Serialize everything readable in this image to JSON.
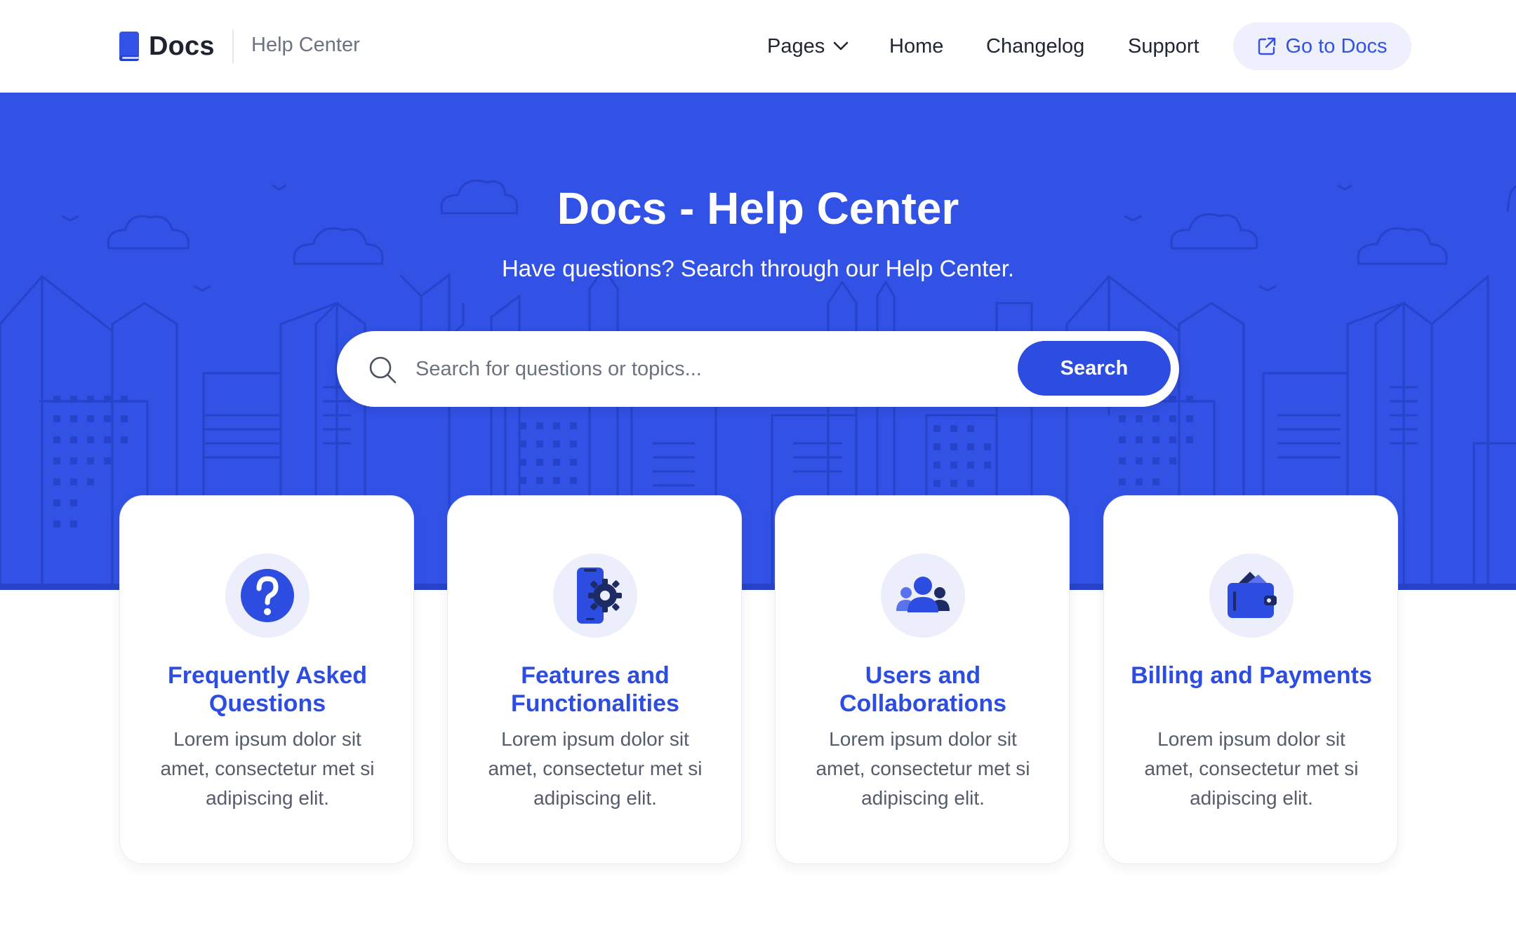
{
  "header": {
    "brand_name": "Docs",
    "brand_sub": "Help Center",
    "nav": {
      "pages": "Pages",
      "home": "Home",
      "changelog": "Changelog",
      "support": "Support"
    },
    "cta_label": "Go to Docs"
  },
  "hero": {
    "title": "Docs - Help Center",
    "subtitle": "Have questions? Search through our Help Center.",
    "search": {
      "placeholder": "Search for questions or topics...",
      "value": "",
      "button_label": "Search"
    }
  },
  "categories": [
    {
      "icon": "question-circle-icon",
      "title": "Frequently Asked Questions",
      "description": "Lorem ipsum dolor sit amet, consectetur met si adipiscing elit."
    },
    {
      "icon": "phone-gear-icon",
      "title": "Features and Functionalities",
      "description": "Lorem ipsum dolor sit amet, consectetur met si adipiscing elit."
    },
    {
      "icon": "users-group-icon",
      "title": "Users and Collaborations",
      "description": "Lorem ipsum dolor sit amet, consectetur met si adipiscing elit."
    },
    {
      "icon": "wallet-icon",
      "title": "Billing and Payments",
      "description": "Lorem ipsum dolor sit amet, consectetur met si adipiscing elit."
    }
  ],
  "colors": {
    "primary": "#3252e6",
    "primary_dark": "#2d4de0",
    "accent_soft": "#eef0fd",
    "icon_navy": "#1c2a66",
    "text_dark": "#1f2633",
    "text_muted": "#6b7280"
  }
}
